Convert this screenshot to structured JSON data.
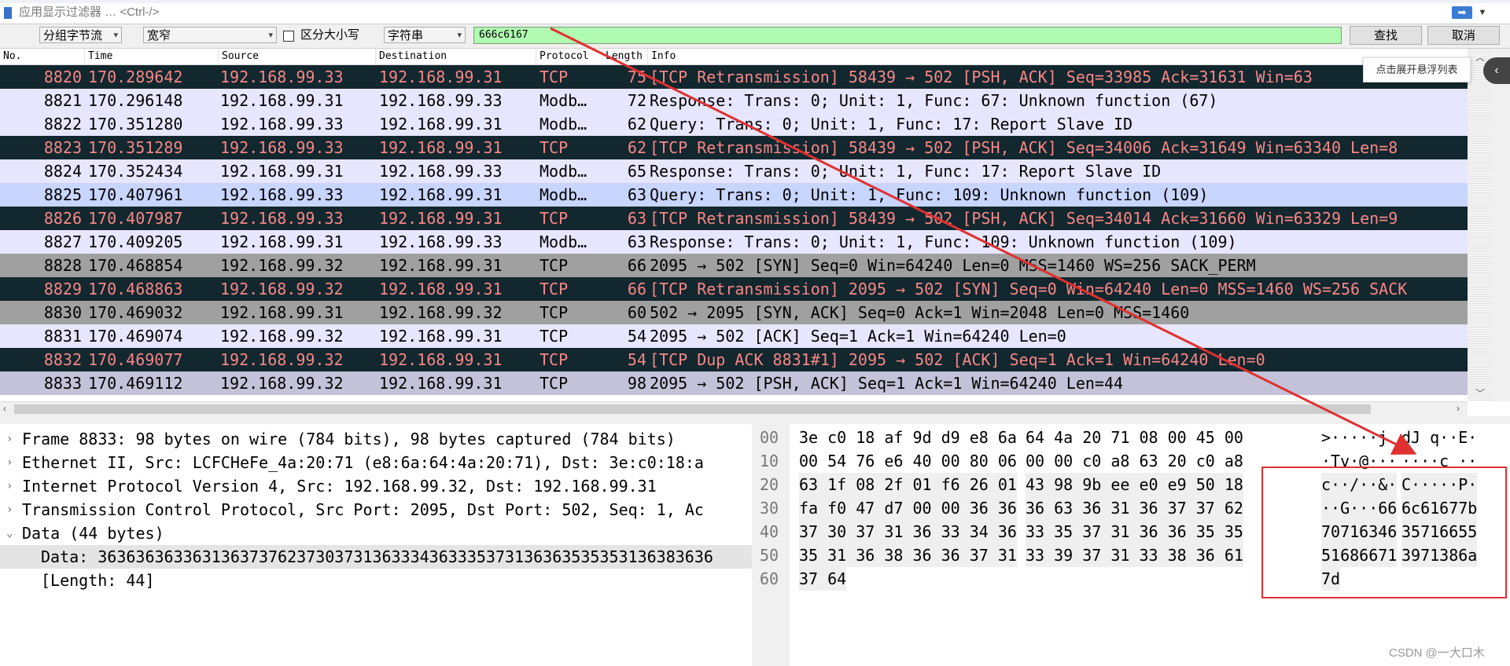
{
  "filter": {
    "placeholder": "应用显示过滤器 … <Ctrl-/>",
    "apply_icon": "arrow-right-icon",
    "dropdown_icon": "chevron-down-icon"
  },
  "find": {
    "search_in": "分组字节流",
    "charset": "宽窄",
    "case_label": "区分大小写",
    "type": "字符串",
    "search_value": "666c6167",
    "find_button": "查找",
    "cancel_button": "取消"
  },
  "packet_list": {
    "columns": [
      "No.",
      "Time",
      "Source",
      "Destination",
      "Protocol",
      "Length",
      "Info"
    ],
    "rows": [
      {
        "no": "8820",
        "time": "170.289642",
        "src": "192.168.99.33",
        "dst": "192.168.99.31",
        "proto": "TCP",
        "len": "75",
        "info": "[TCP Retransmission] 58439 → 502 [PSH, ACK] Seq=33985 Ack=31631 Win=63",
        "style": "bad"
      },
      {
        "no": "8821",
        "time": "170.296148",
        "src": "192.168.99.31",
        "dst": "192.168.99.33",
        "proto": "Modb…",
        "len": "72",
        "info": "Response: Trans:      0; Unit:   1, Func:  67: Unknown function (67)",
        "style": "lav"
      },
      {
        "no": "8822",
        "time": "170.351280",
        "src": "192.168.99.33",
        "dst": "192.168.99.31",
        "proto": "Modb…",
        "len": "62",
        "info": "   Query: Trans:      0; Unit:   1, Func:  17: Report Slave ID",
        "style": "lav"
      },
      {
        "no": "8823",
        "time": "170.351289",
        "src": "192.168.99.33",
        "dst": "192.168.99.31",
        "proto": "TCP",
        "len": "62",
        "info": "[TCP Retransmission] 58439 → 502 [PSH, ACK] Seq=34006 Ack=31649 Win=63340 Len=8",
        "style": "bad"
      },
      {
        "no": "8824",
        "time": "170.352434",
        "src": "192.168.99.31",
        "dst": "192.168.99.33",
        "proto": "Modb…",
        "len": "65",
        "info": "Response: Trans:      0; Unit:   1, Func:  17: Report Slave ID",
        "style": "lav"
      },
      {
        "no": "8825",
        "time": "170.407961",
        "src": "192.168.99.33",
        "dst": "192.168.99.31",
        "proto": "Modb…",
        "len": "63",
        "info": "   Query: Trans:      0; Unit:   1, Func: 109: Unknown function (109)",
        "style": "blue"
      },
      {
        "no": "8826",
        "time": "170.407987",
        "src": "192.168.99.33",
        "dst": "192.168.99.31",
        "proto": "TCP",
        "len": "63",
        "info": "[TCP Retransmission] 58439 → 502 [PSH, ACK] Seq=34014 Ack=31660 Win=63329 Len=9",
        "style": "bad"
      },
      {
        "no": "8827",
        "time": "170.409205",
        "src": "192.168.99.31",
        "dst": "192.168.99.33",
        "proto": "Modb…",
        "len": "63",
        "info": "Response: Trans:      0; Unit:   1, Func: 109: Unknown function (109)",
        "style": "lav"
      },
      {
        "no": "8828",
        "time": "170.468854",
        "src": "192.168.99.32",
        "dst": "192.168.99.31",
        "proto": "TCP",
        "len": "66",
        "info": "2095 → 502 [SYN] Seq=0 Win=64240 Len=0 MSS=1460 WS=256 SACK_PERM",
        "style": "gray"
      },
      {
        "no": "8829",
        "time": "170.468863",
        "src": "192.168.99.32",
        "dst": "192.168.99.31",
        "proto": "TCP",
        "len": "66",
        "info": "[TCP Retransmission] 2095 → 502 [SYN] Seq=0 Win=64240 Len=0 MSS=1460 WS=256 SACK",
        "style": "bad"
      },
      {
        "no": "8830",
        "time": "170.469032",
        "src": "192.168.99.31",
        "dst": "192.168.99.32",
        "proto": "TCP",
        "len": "60",
        "info": "502 → 2095 [SYN, ACK] Seq=0 Ack=1 Win=2048 Len=0 MSS=1460",
        "style": "gray"
      },
      {
        "no": "8831",
        "time": "170.469074",
        "src": "192.168.99.32",
        "dst": "192.168.99.31",
        "proto": "TCP",
        "len": "54",
        "info": "2095 → 502 [ACK] Seq=1 Ack=1 Win=64240 Len=0",
        "style": "lav"
      },
      {
        "no": "8832",
        "time": "170.469077",
        "src": "192.168.99.32",
        "dst": "192.168.99.31",
        "proto": "TCP",
        "len": "54",
        "info": "[TCP Dup ACK 8831#1] 2095 → 502 [ACK] Seq=1 Ack=1 Win=64240 Len=0",
        "style": "bad"
      },
      {
        "no": "8833",
        "time": "170.469112",
        "src": "192.168.99.32",
        "dst": "192.168.99.31",
        "proto": "TCP",
        "len": "98",
        "info": "2095 → 502 [PSH, ACK] Seq=1 Ack=1 Win=64240 Len=44",
        "style": "sel"
      }
    ]
  },
  "tooltip": {
    "expand_label": "点击展开悬浮列表",
    "expand_icon": "chevron-left-icon"
  },
  "details": {
    "lines": [
      {
        "text": "Frame 8833: 98 bytes on wire (784 bits), 98 bytes captured (784 bits)",
        "toggle": "›"
      },
      {
        "text": "Ethernet II, Src: LCFCHeFe_4a:20:71 (e8:6a:64:4a:20:71), Dst: 3e:c0:18:a",
        "toggle": "›"
      },
      {
        "text": "Internet Protocol Version 4, Src: 192.168.99.32, Dst: 192.168.99.31",
        "toggle": "›"
      },
      {
        "text": "Transmission Control Protocol, Src Port: 2095, Dst Port: 502, Seq: 1, Ac",
        "toggle": "›"
      },
      {
        "text": "Data (44 bytes)",
        "toggle": "⌄"
      },
      {
        "text": "Data: 36363636336313637376237303731363334363335373136363535353136383636",
        "toggle": ""
      },
      {
        "text": "[Length: 44]",
        "toggle": ""
      }
    ]
  },
  "bytes": {
    "rows": [
      {
        "off": "00",
        "hex1": "3e c0 18 af 9d d9 e8 6a",
        "hex2": "64 4a 20 71 08 00 45 00",
        "ascii1": ">·····j",
        "ascii2": "dJ q··E·"
      },
      {
        "off": "10",
        "hex1": "00 54 76 e6 40 00 80 06",
        "hex2": "00 00 c0 a8 63 20 c0 a8",
        "ascii1": "·Tv·@···",
        "ascii2": "····c ··"
      },
      {
        "off": "20",
        "hex1": "63 1f 08 2f 01 f6 26 01",
        "hex2": "43 98 9b ee e0 e9 50 18",
        "ascii1": "c··/··&·",
        "ascii2": "C·····P·"
      },
      {
        "off": "30",
        "hex1": "fa f0 47 d7 00 00 36 36",
        "hex2": "36 63 36 31 36 37 37 62",
        "ascii1": "··G···66",
        "ascii2": "6c61677b"
      },
      {
        "off": "40",
        "hex1": "37 30 37 31 36 33 34 36",
        "hex2": "33 35 37 31 36 36 35 35",
        "ascii1": "70716346",
        "ascii2": "35716655"
      },
      {
        "off": "50",
        "hex1": "35 31 36 38 36 36 37 31",
        "hex2": "33 39 37 31 33 38 36 61",
        "ascii1": "51686671",
        "ascii2": "3971386a"
      },
      {
        "off": "60",
        "hex1": "37 64",
        "hex2": "",
        "ascii1": "7d",
        "ascii2": ""
      }
    ]
  },
  "watermark": "CSDN @一大口木",
  "colors": {
    "bad_bg": "#12272e",
    "bad_fg": "#f78787",
    "lav_bg": "#e7e6ff",
    "blue_bg": "#c8d5ff",
    "gray_bg": "#a0a0a0",
    "sel_bg": "#c4c2d8",
    "arrow": "#e03030"
  }
}
